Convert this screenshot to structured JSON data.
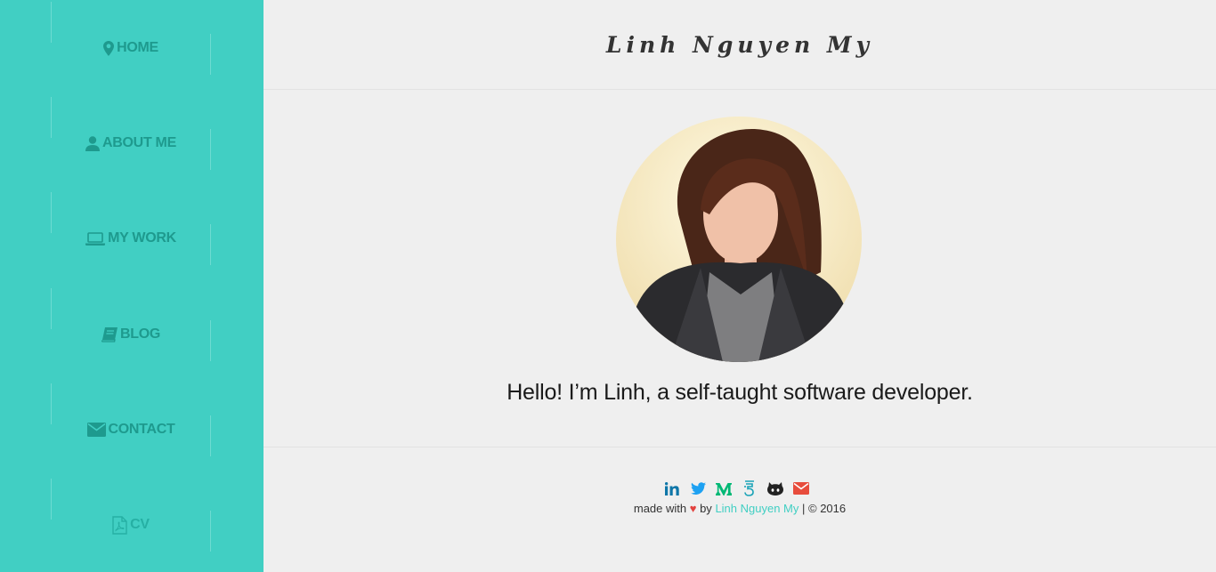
{
  "sidebar": {
    "items": [
      {
        "label": "HOME",
        "icon": "map-marker-icon"
      },
      {
        "label": "ABOUT ME",
        "icon": "user-icon"
      },
      {
        "label": "MY WORK",
        "icon": "laptop-icon"
      },
      {
        "label": "BLOG",
        "icon": "book-icon"
      },
      {
        "label": "CONTACT",
        "icon": "envelope-icon"
      },
      {
        "label": "CV",
        "icon": "file-pdf-icon"
      }
    ]
  },
  "header": {
    "title": "Linh Nguyen My"
  },
  "main": {
    "intro": "Hello! I’m Linh, a self-taught software developer."
  },
  "social": [
    {
      "icon": "linkedin-icon",
      "color": "#0e76a8"
    },
    {
      "icon": "twitter-icon",
      "color": "#1da1f2"
    },
    {
      "icon": "medium-icon",
      "color": "#02b875"
    },
    {
      "icon": "freecodecamp-icon",
      "color": "#1aa3b7"
    },
    {
      "icon": "github-icon",
      "color": "#222222"
    },
    {
      "icon": "email-icon",
      "color": "#e74c3c"
    }
  ],
  "footer": {
    "made_with": "made with",
    "heart": "♥",
    "by": "by",
    "author": "Linh Nguyen My",
    "copyright": "| © 2016"
  },
  "colors": {
    "accent": "#41cfc3",
    "nav_text": "#1e9a8e",
    "background": "#efefef"
  }
}
